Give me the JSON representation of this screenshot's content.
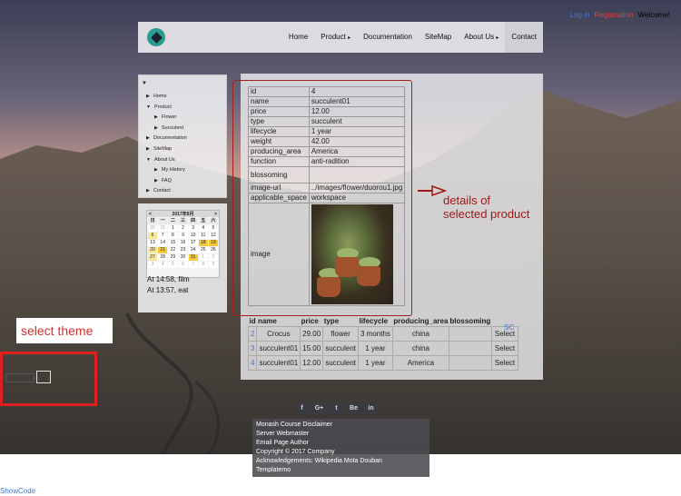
{
  "header": {
    "login": "Log in",
    "register": "Registration",
    "welcome": "Welcome!"
  },
  "nav": {
    "items": [
      {
        "label": "Home",
        "has_arrow": false
      },
      {
        "label": "Product",
        "has_arrow": true
      },
      {
        "label": "Documentation",
        "has_arrow": false
      },
      {
        "label": "SiteMap",
        "has_arrow": false
      },
      {
        "label": "About Us",
        "has_arrow": true
      },
      {
        "label": "Contact",
        "has_arrow": false
      }
    ],
    "active": "Contact"
  },
  "sidebar": {
    "tree": [
      {
        "label": "Home",
        "level": 0,
        "expanded": false
      },
      {
        "label": "Product",
        "level": 0,
        "expanded": true
      },
      {
        "label": "Flower",
        "level": 1,
        "expanded": false
      },
      {
        "label": "Succulent",
        "level": 1,
        "expanded": false
      },
      {
        "label": "Documentation",
        "level": 0,
        "expanded": false
      },
      {
        "label": "SiteMap",
        "level": 0,
        "expanded": false
      },
      {
        "label": "About Us",
        "level": 0,
        "expanded": true
      },
      {
        "label": "My History",
        "level": 1,
        "expanded": false
      },
      {
        "label": "FAQ",
        "level": 1,
        "expanded": false
      },
      {
        "label": "Contact",
        "level": 0,
        "expanded": false
      }
    ]
  },
  "calendar": {
    "month_label": "2017年8月",
    "prev": "<",
    "next": ">",
    "weekdays": [
      "日",
      "一",
      "二",
      "三",
      "四",
      "五",
      "六"
    ],
    "days": [
      [
        "30",
        "31",
        "1",
        "2",
        "3",
        "4",
        "5"
      ],
      [
        "6",
        "7",
        "8",
        "9",
        "10",
        "11",
        "12"
      ],
      [
        "13",
        "14",
        "15",
        "16",
        "17",
        "18",
        "19"
      ],
      [
        "20",
        "21",
        "22",
        "23",
        "24",
        "25",
        "26"
      ],
      [
        "27",
        "28",
        "29",
        "30",
        "31",
        "1",
        "2"
      ],
      [
        "3",
        "4",
        "5",
        "6",
        "7",
        "8",
        "9"
      ]
    ]
  },
  "schedule": [
    "At 14:58, film",
    "At 13:57, eat"
  ],
  "product_detail": {
    "rows": [
      {
        "key": "id",
        "value": "4"
      },
      {
        "key": "name",
        "value": "succulent01"
      },
      {
        "key": "price",
        "value": "12.00"
      },
      {
        "key": "type",
        "value": "succulent"
      },
      {
        "key": "lifecycle",
        "value": "1 year"
      },
      {
        "key": "weight",
        "value": "42.00"
      },
      {
        "key": "producing_area",
        "value": "America"
      },
      {
        "key": "function",
        "value": "anti-radition"
      },
      {
        "key": "blossoming",
        "value": ""
      },
      {
        "key": "image-url",
        "value": "../images/flower/duorou1.jpg"
      },
      {
        "key": "applicable_space",
        "value": "workspace"
      }
    ],
    "image_label": "image"
  },
  "annotation": {
    "line1": "details of",
    "line2": "selected product",
    "color": "#a01818"
  },
  "results": {
    "headers": [
      "id",
      "name",
      "price",
      "type",
      "lifecycle",
      "producing_area",
      "blossoming",
      ""
    ],
    "rows": [
      {
        "id": "2",
        "name": "Crocus",
        "price": "29.00",
        "type": "flower",
        "lifecycle": "3 months",
        "producing_area": "china",
        "blossoming": "",
        "action": "Select"
      },
      {
        "id": "3",
        "name": "succulent01",
        "price": "15.00",
        "type": "succulent",
        "lifecycle": "1 year",
        "producing_area": "china",
        "blossoming": "",
        "action": "Select"
      },
      {
        "id": "4",
        "name": "succulent01",
        "price": "12.00",
        "type": "succulent",
        "lifecycle": "1 year",
        "producing_area": "America",
        "blossoming": "",
        "action": "Select"
      }
    ],
    "side_link": "SC"
  },
  "theme_selector": {
    "label": "select theme"
  },
  "social_icons": [
    "f",
    "G+",
    "t",
    "Be",
    "in"
  ],
  "footer": {
    "lines": [
      "Monash Course Disclaimer",
      "Server Webmaster",
      "Email Page Author",
      "Copyright © 2017 Company",
      "Acknowledgements: Wikipedia   Mota   Douban",
      "Templatemo"
    ]
  },
  "show_code": "ShowCode"
}
